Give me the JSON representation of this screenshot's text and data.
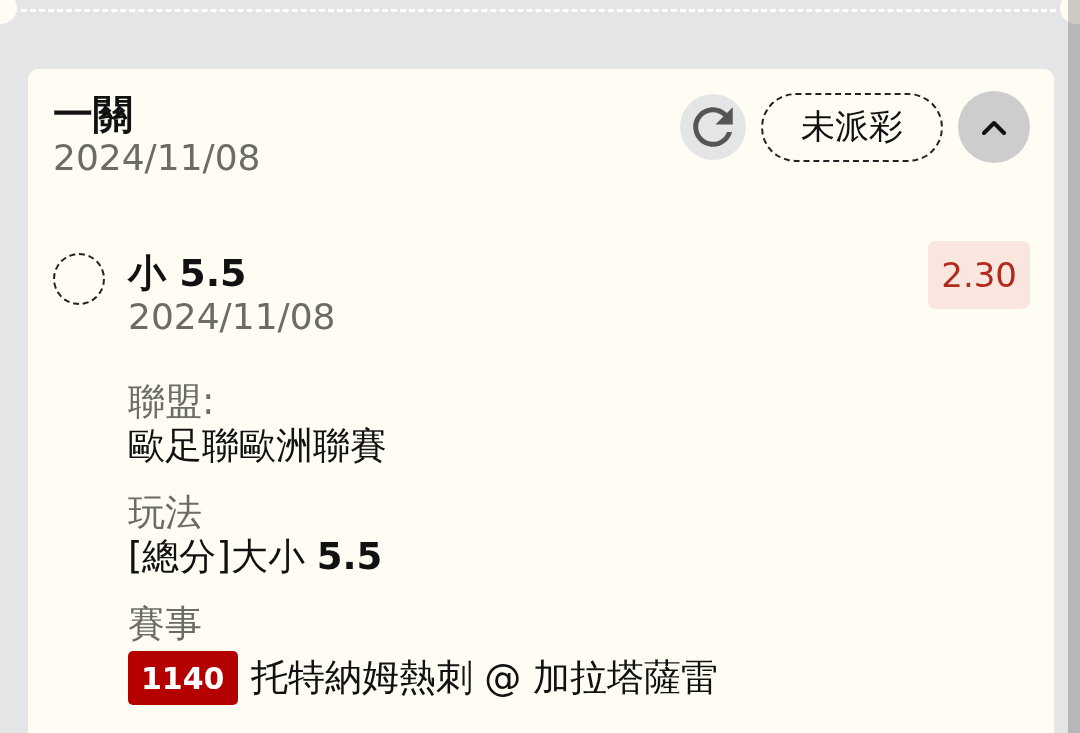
{
  "bet_slip": {
    "title": "一關",
    "date": "2024/11/08",
    "status": "未派彩",
    "expanded": true
  },
  "selections": [
    {
      "selected": false,
      "name": "小 5.5",
      "date": "2024/11/08",
      "odds": "2.30",
      "details": [
        {
          "kind": "text",
          "label": "聯盟:",
          "value": "歐足聯歐洲聯賽"
        },
        {
          "kind": "text",
          "label": "玩法",
          "value": "[總分]大小 **5.5**"
        },
        {
          "kind": "match",
          "label": "賽事",
          "match_number": "1140",
          "value": "托特納姆熱刺 @ 加拉塔薩雷"
        }
      ]
    }
  ]
}
